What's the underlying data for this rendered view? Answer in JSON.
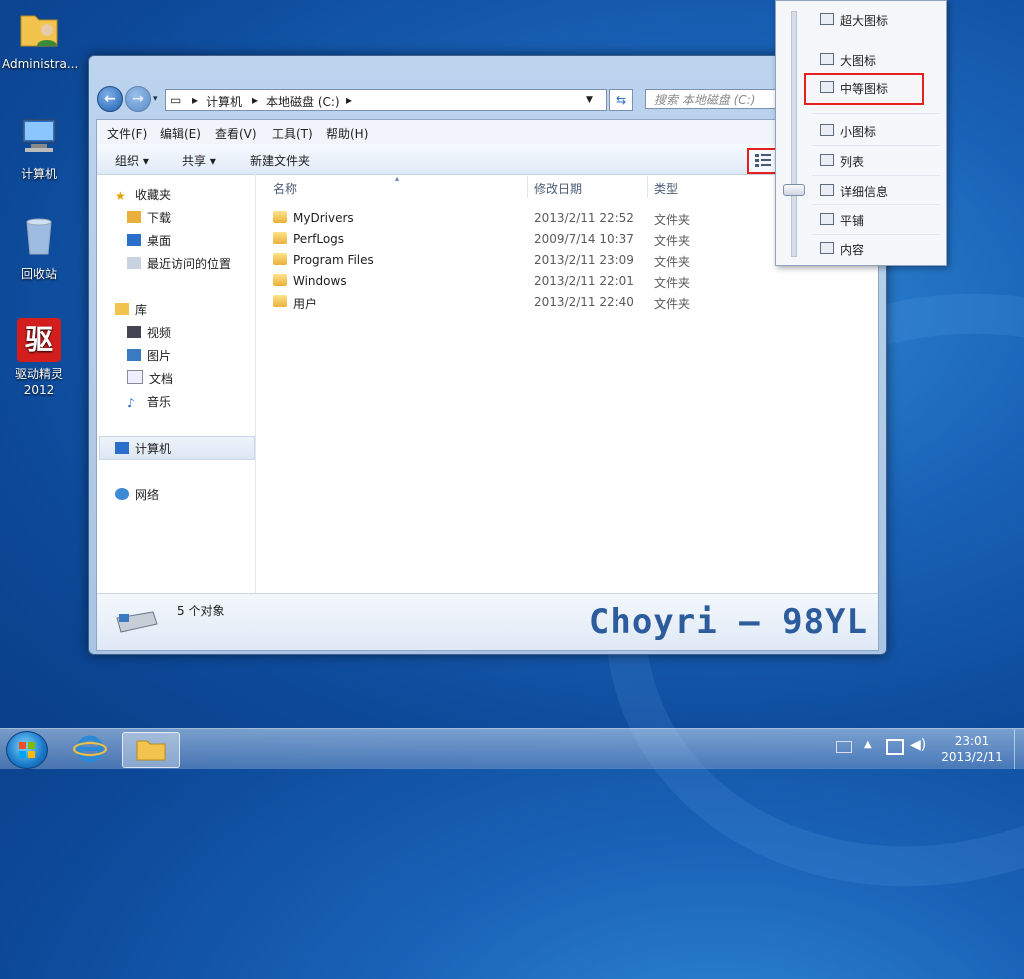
{
  "desktop": {
    "icons": [
      {
        "name": "desktop-icon-admin",
        "label": "Administra..."
      },
      {
        "name": "desktop-icon-computer",
        "label": "计算机"
      },
      {
        "name": "desktop-icon-recycle",
        "label": "回收站"
      },
      {
        "name": "desktop-icon-driver",
        "label": "驱动精灵\n2012",
        "glyph_text": "驱"
      }
    ]
  },
  "explorer": {
    "breadcrumb": [
      "计算机",
      "本地磁盘 (C:)"
    ],
    "search_placeholder": "搜索 本地磁盘 (C:)",
    "menu": [
      "文件(F)",
      "编辑(E)",
      "查看(V)",
      "工具(T)",
      "帮助(H)"
    ],
    "commands": [
      "组织 ▾",
      "共享 ▾",
      "新建文件夹"
    ],
    "sidebar": {
      "favorites": "收藏夹",
      "fav_items": [
        "下载",
        "桌面",
        "最近访问的位置"
      ],
      "libraries": "库",
      "lib_items": [
        "视频",
        "图片",
        "文档",
        "音乐"
      ],
      "computer": "计算机",
      "network": "网络"
    },
    "columns": [
      "名称",
      "修改日期",
      "类型"
    ],
    "files": [
      {
        "name": "MyDrivers",
        "date": "2013/2/11 22:52",
        "type": "文件夹"
      },
      {
        "name": "PerfLogs",
        "date": "2009/7/14 10:37",
        "type": "文件夹"
      },
      {
        "name": "Program Files",
        "date": "2013/2/11 23:09",
        "type": "文件夹"
      },
      {
        "name": "Windows",
        "date": "2013/2/11 22:01",
        "type": "文件夹"
      },
      {
        "name": "用户",
        "date": "2013/2/11 22:40",
        "type": "文件夹"
      }
    ],
    "status_count": "5 个对象",
    "watermark": "Choyri — 98YL"
  },
  "view_menu": {
    "items": [
      "超大图标",
      "大图标",
      "中等图标",
      "小图标",
      "列表",
      "详细信息",
      "平铺",
      "内容"
    ],
    "selected": "中等图标"
  },
  "taskbar": {
    "time": "23:01",
    "date": "2013/2/11"
  },
  "colors": {
    "highlight_border": "#e52020",
    "desktop_blue": "#1a63b8"
  }
}
